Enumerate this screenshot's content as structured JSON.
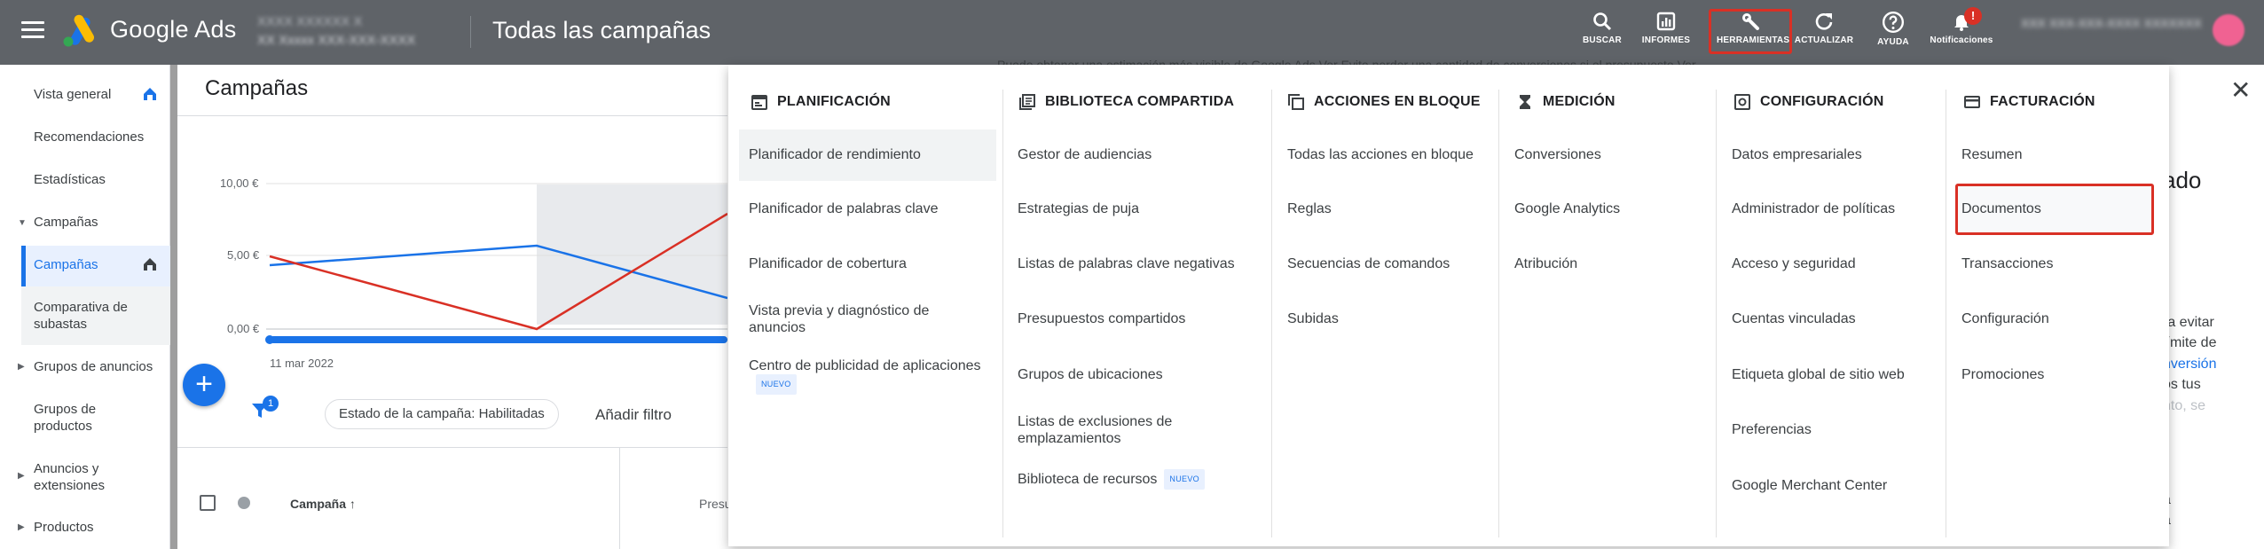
{
  "topbar": {
    "brand": "Google Ads",
    "account_line1": "XXXX XXXXXX X",
    "account_line2": "XX Xxxxx  XXX-XXX-XXXX",
    "page_title": "Todas las campañas",
    "buttons": [
      {
        "label": "BUSCAR",
        "icon": "search-icon"
      },
      {
        "label": "INFORMES",
        "icon": "reports-icon"
      },
      {
        "label": "HERRAMIENTAS",
        "icon": "wrench-icon"
      },
      {
        "label": "ACTUALIZAR",
        "icon": "refresh-icon"
      },
      {
        "label": "AYUDA",
        "icon": "help-icon"
      },
      {
        "label": "Notificaciones",
        "icon": "bell-icon"
      }
    ],
    "notification_badge": "!",
    "user_blurred": "XXX XXX-XXX-XXXX XXXXXXX"
  },
  "sidebar": {
    "items": [
      {
        "label": "Vista general",
        "icon": "home-icon"
      },
      {
        "label": "Recomendaciones"
      },
      {
        "label": "Estadísticas"
      },
      {
        "label": "Campañas",
        "expanded": true
      },
      {
        "label": "Campañas",
        "icon": "home-icon",
        "active": true
      },
      {
        "label": "Comparativa de subastas"
      },
      {
        "label": "Grupos de anuncios"
      },
      {
        "label": "Grupos de productos"
      },
      {
        "label": "Anuncios y extensiones"
      },
      {
        "label": "Productos"
      }
    ]
  },
  "main": {
    "title": "Campañas",
    "chart_y_labels": [
      "10,00 €",
      "5,00 €",
      "0,00 €"
    ],
    "chart_x_label": "11 mar 2022",
    "filter_badge": "1",
    "filter_chip": "Estado de la campaña: Habilitadas",
    "add_filter": "Añadir filtro",
    "col_campaign": "Campaña",
    "col_budget": "Presu"
  },
  "right_panel": {
    "title_fragment": "ado",
    "lines": [
      "ra evitar",
      "límite de",
      "nversión",
      "os tus",
      "nto, se",
      "a",
      "a"
    ]
  },
  "notification_strip": "Puede obtener una estimación más visible de Google Ads  Ver     Evite perder una cantidad de conversiones si el presupuesto  Ver",
  "menu": {
    "nuevo_badge": "NUEVO",
    "columns": [
      {
        "header": "PLANIFICACIÓN",
        "items": [
          "Planificador de rendimiento",
          "Planificador de palabras clave",
          "Planificador de cobertura",
          "Vista previa y diagnóstico de anuncios",
          "Centro de publicidad de aplicaciones"
        ]
      },
      {
        "header": "BIBLIOTECA COMPARTIDA",
        "items": [
          "Gestor de audiencias",
          "Estrategias de puja",
          "Listas de palabras clave negativas",
          "Presupuestos compartidos",
          "Grupos de ubicaciones",
          "Listas de exclusiones de emplazamientos",
          "Biblioteca de recursos"
        ]
      },
      {
        "header": "ACCIONES EN BLOQUE",
        "items": [
          "Todas las acciones en bloque",
          "Reglas",
          "Secuencias de comandos",
          "Subidas"
        ]
      },
      {
        "header": "MEDICIÓN",
        "items": [
          "Conversiones",
          "Google Analytics",
          "Atribución"
        ]
      },
      {
        "header": "CONFIGURACIÓN",
        "items": [
          "Datos empresariales",
          "Administrador de políticas",
          "Acceso y seguridad",
          "Cuentas vinculadas",
          "Etiqueta global de sitio web",
          "Preferencias",
          "Google Merchant Center"
        ]
      },
      {
        "header": "FACTURACIÓN",
        "items": [
          "Resumen",
          "Documentos",
          "Transacciones",
          "Configuración",
          "Promociones"
        ]
      }
    ]
  },
  "colors": {
    "topbar": "#5f6368",
    "accent": "#1a73e8",
    "highlight": "#d93025"
  }
}
